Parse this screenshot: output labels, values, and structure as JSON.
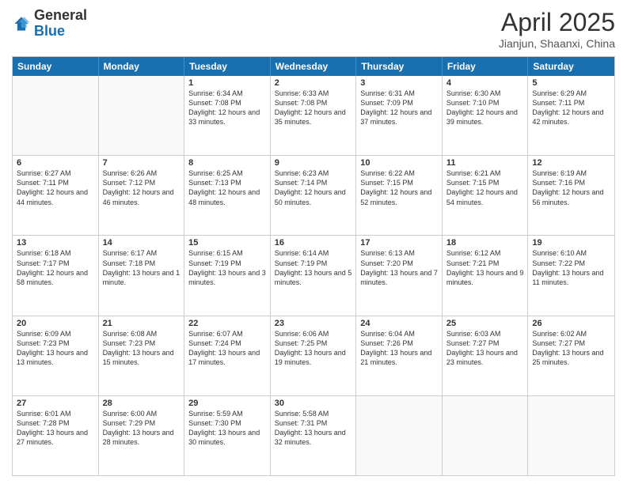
{
  "header": {
    "logo_general": "General",
    "logo_blue": "Blue",
    "title": "April 2025",
    "subtitle": "Jianjun, Shaanxi, China"
  },
  "days_of_week": [
    "Sunday",
    "Monday",
    "Tuesday",
    "Wednesday",
    "Thursday",
    "Friday",
    "Saturday"
  ],
  "rows": [
    [
      {
        "day": "",
        "empty": true
      },
      {
        "day": "",
        "empty": true
      },
      {
        "day": "1",
        "sunrise": "Sunrise: 6:34 AM",
        "sunset": "Sunset: 7:08 PM",
        "daylight": "Daylight: 12 hours and 33 minutes."
      },
      {
        "day": "2",
        "sunrise": "Sunrise: 6:33 AM",
        "sunset": "Sunset: 7:08 PM",
        "daylight": "Daylight: 12 hours and 35 minutes."
      },
      {
        "day": "3",
        "sunrise": "Sunrise: 6:31 AM",
        "sunset": "Sunset: 7:09 PM",
        "daylight": "Daylight: 12 hours and 37 minutes."
      },
      {
        "day": "4",
        "sunrise": "Sunrise: 6:30 AM",
        "sunset": "Sunset: 7:10 PM",
        "daylight": "Daylight: 12 hours and 39 minutes."
      },
      {
        "day": "5",
        "sunrise": "Sunrise: 6:29 AM",
        "sunset": "Sunset: 7:11 PM",
        "daylight": "Daylight: 12 hours and 42 minutes."
      }
    ],
    [
      {
        "day": "6",
        "sunrise": "Sunrise: 6:27 AM",
        "sunset": "Sunset: 7:11 PM",
        "daylight": "Daylight: 12 hours and 44 minutes."
      },
      {
        "day": "7",
        "sunrise": "Sunrise: 6:26 AM",
        "sunset": "Sunset: 7:12 PM",
        "daylight": "Daylight: 12 hours and 46 minutes."
      },
      {
        "day": "8",
        "sunrise": "Sunrise: 6:25 AM",
        "sunset": "Sunset: 7:13 PM",
        "daylight": "Daylight: 12 hours and 48 minutes."
      },
      {
        "day": "9",
        "sunrise": "Sunrise: 6:23 AM",
        "sunset": "Sunset: 7:14 PM",
        "daylight": "Daylight: 12 hours and 50 minutes."
      },
      {
        "day": "10",
        "sunrise": "Sunrise: 6:22 AM",
        "sunset": "Sunset: 7:15 PM",
        "daylight": "Daylight: 12 hours and 52 minutes."
      },
      {
        "day": "11",
        "sunrise": "Sunrise: 6:21 AM",
        "sunset": "Sunset: 7:15 PM",
        "daylight": "Daylight: 12 hours and 54 minutes."
      },
      {
        "day": "12",
        "sunrise": "Sunrise: 6:19 AM",
        "sunset": "Sunset: 7:16 PM",
        "daylight": "Daylight: 12 hours and 56 minutes."
      }
    ],
    [
      {
        "day": "13",
        "sunrise": "Sunrise: 6:18 AM",
        "sunset": "Sunset: 7:17 PM",
        "daylight": "Daylight: 12 hours and 58 minutes."
      },
      {
        "day": "14",
        "sunrise": "Sunrise: 6:17 AM",
        "sunset": "Sunset: 7:18 PM",
        "daylight": "Daylight: 13 hours and 1 minute."
      },
      {
        "day": "15",
        "sunrise": "Sunrise: 6:15 AM",
        "sunset": "Sunset: 7:19 PM",
        "daylight": "Daylight: 13 hours and 3 minutes."
      },
      {
        "day": "16",
        "sunrise": "Sunrise: 6:14 AM",
        "sunset": "Sunset: 7:19 PM",
        "daylight": "Daylight: 13 hours and 5 minutes."
      },
      {
        "day": "17",
        "sunrise": "Sunrise: 6:13 AM",
        "sunset": "Sunset: 7:20 PM",
        "daylight": "Daylight: 13 hours and 7 minutes."
      },
      {
        "day": "18",
        "sunrise": "Sunrise: 6:12 AM",
        "sunset": "Sunset: 7:21 PM",
        "daylight": "Daylight: 13 hours and 9 minutes."
      },
      {
        "day": "19",
        "sunrise": "Sunrise: 6:10 AM",
        "sunset": "Sunset: 7:22 PM",
        "daylight": "Daylight: 13 hours and 11 minutes."
      }
    ],
    [
      {
        "day": "20",
        "sunrise": "Sunrise: 6:09 AM",
        "sunset": "Sunset: 7:23 PM",
        "daylight": "Daylight: 13 hours and 13 minutes."
      },
      {
        "day": "21",
        "sunrise": "Sunrise: 6:08 AM",
        "sunset": "Sunset: 7:23 PM",
        "daylight": "Daylight: 13 hours and 15 minutes."
      },
      {
        "day": "22",
        "sunrise": "Sunrise: 6:07 AM",
        "sunset": "Sunset: 7:24 PM",
        "daylight": "Daylight: 13 hours and 17 minutes."
      },
      {
        "day": "23",
        "sunrise": "Sunrise: 6:06 AM",
        "sunset": "Sunset: 7:25 PM",
        "daylight": "Daylight: 13 hours and 19 minutes."
      },
      {
        "day": "24",
        "sunrise": "Sunrise: 6:04 AM",
        "sunset": "Sunset: 7:26 PM",
        "daylight": "Daylight: 13 hours and 21 minutes."
      },
      {
        "day": "25",
        "sunrise": "Sunrise: 6:03 AM",
        "sunset": "Sunset: 7:27 PM",
        "daylight": "Daylight: 13 hours and 23 minutes."
      },
      {
        "day": "26",
        "sunrise": "Sunrise: 6:02 AM",
        "sunset": "Sunset: 7:27 PM",
        "daylight": "Daylight: 13 hours and 25 minutes."
      }
    ],
    [
      {
        "day": "27",
        "sunrise": "Sunrise: 6:01 AM",
        "sunset": "Sunset: 7:28 PM",
        "daylight": "Daylight: 13 hours and 27 minutes."
      },
      {
        "day": "28",
        "sunrise": "Sunrise: 6:00 AM",
        "sunset": "Sunset: 7:29 PM",
        "daylight": "Daylight: 13 hours and 28 minutes."
      },
      {
        "day": "29",
        "sunrise": "Sunrise: 5:59 AM",
        "sunset": "Sunset: 7:30 PM",
        "daylight": "Daylight: 13 hours and 30 minutes."
      },
      {
        "day": "30",
        "sunrise": "Sunrise: 5:58 AM",
        "sunset": "Sunset: 7:31 PM",
        "daylight": "Daylight: 13 hours and 32 minutes."
      },
      {
        "day": "",
        "empty": true
      },
      {
        "day": "",
        "empty": true
      },
      {
        "day": "",
        "empty": true
      }
    ]
  ]
}
